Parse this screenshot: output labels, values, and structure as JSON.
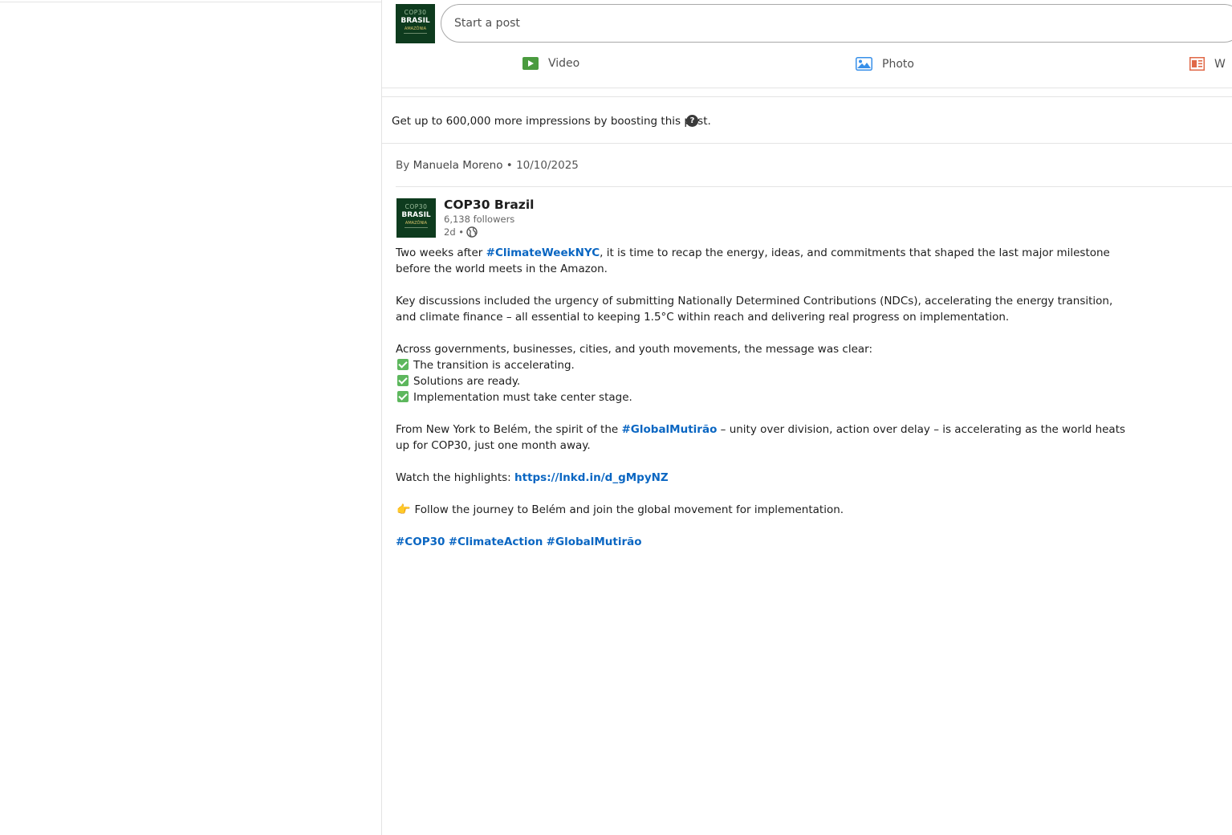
{
  "logo": {
    "line1": "COP30",
    "line2": "BRASIL",
    "line3": "AMAZÔNIA"
  },
  "composer": {
    "placeholder": "Start a post",
    "actions": {
      "video": "Video",
      "photo": "Photo",
      "write": "W"
    }
  },
  "boost": {
    "text": "Get up to 600,000 more impressions by boosting this post.",
    "help_symbol": "?"
  },
  "byline": {
    "prefix": "By",
    "author": "Manuela Moreno",
    "separator": "•",
    "date": "10/10/2025"
  },
  "post": {
    "org_name": "COP30 Brazil",
    "followers": "6,138 followers",
    "age": "2d •",
    "para1_pre": "Two weeks after ",
    "para1_tag": "#ClimateWeekNYC",
    "para1_post": ", it is time to recap the energy, ideas, and commitments that shaped the last major milestone before the world meets in the Amazon.",
    "para2": "Key discussions included the urgency of submitting Nationally Determined Contributions (NDCs), accelerating the energy transition, and climate finance – all essential to keeping 1.5°C within reach and delivering real progress on implementation.",
    "para3_intro": "Across governments, businesses, cities, and youth movements, the message was clear:",
    "checklist": [
      "The transition is accelerating.",
      "Solutions are ready.",
      "Implementation must take center stage."
    ],
    "para4_pre": "From New York to Belém, the spirit of the ",
    "para4_tag": "#GlobalMutirão",
    "para4_post": " – unity over division, action over delay – is accelerating as the world heats up for COP30, just one month away.",
    "watch_pre": "Watch the highlights: ",
    "watch_link": "https://lnkd.in/d_gMpyNZ",
    "hand_emoji": "👉",
    "follow_text": "Follow the journey to Belém and join the global movement for implementation.",
    "hashtags": [
      "#COP30",
      "#ClimateAction",
      "#GlobalMutirão"
    ]
  },
  "colors": {
    "link": "#0a66c2",
    "logo_bg": "#0e3b1e",
    "check_green": "#5db75d",
    "video_icon": "#4a9b3f",
    "photo_icon": "#378fe9",
    "article_icon": "#e06847"
  }
}
